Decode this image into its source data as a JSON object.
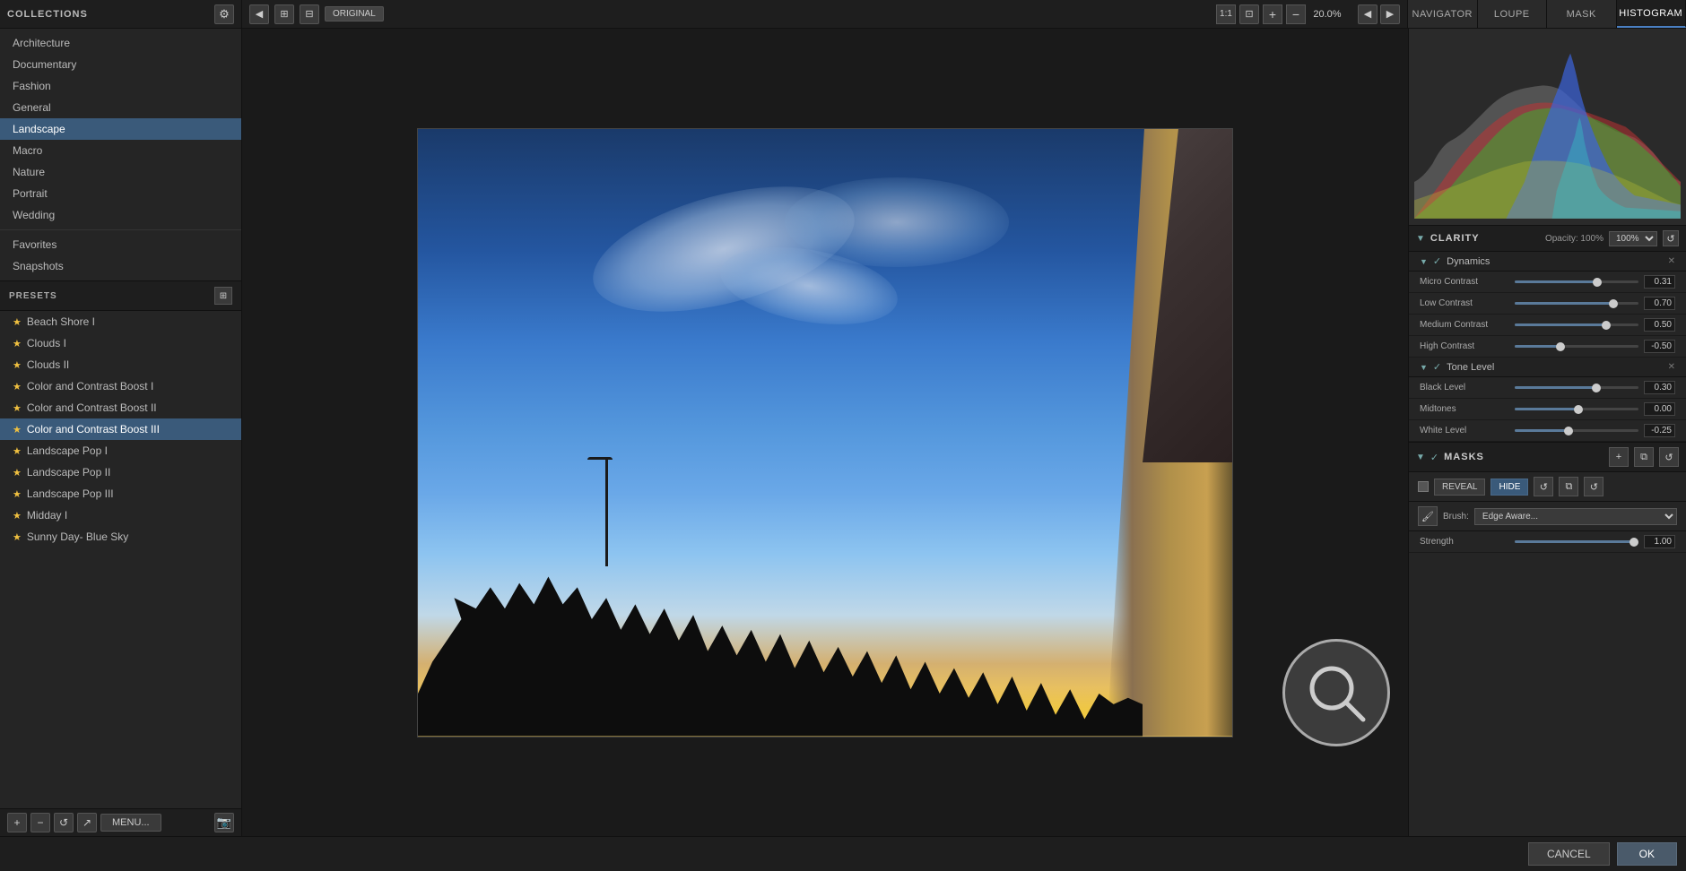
{
  "topbar": {
    "collections_label": "COLLECTIONS",
    "gear_icon": "⚙",
    "nav_prev_icon": "◀",
    "nav_next_icon": "▶",
    "view_icon1": "⊞",
    "view_icon2": "⊟",
    "original_label": "ORIGINAL",
    "zoom_1to1_label": "1:1",
    "fit_icon": "⊡",
    "zoom_in_icon": "+",
    "zoom_out_icon": "−",
    "zoom_percent": "20.0%",
    "toolbar_nav_prev": "◀",
    "toolbar_nav_next": "▶",
    "tabs": {
      "navigator": "NAVIGATOR",
      "loupe": "LOUPE",
      "mask": "MASK",
      "histogram": "HISTOGRAM"
    }
  },
  "collections": {
    "items": [
      {
        "label": "Architecture",
        "active": false
      },
      {
        "label": "Documentary",
        "active": false
      },
      {
        "label": "Fashion",
        "active": false
      },
      {
        "label": "General",
        "active": false
      },
      {
        "label": "Landscape",
        "active": true
      },
      {
        "label": "Macro",
        "active": false
      },
      {
        "label": "Nature",
        "active": false
      },
      {
        "label": "Portrait",
        "active": false
      },
      {
        "label": "Wedding",
        "active": false
      },
      {
        "label": "Favorites",
        "active": false
      },
      {
        "label": "Snapshots",
        "active": false
      }
    ]
  },
  "presets": {
    "title": "PRESETS",
    "grid_icon": "⊞",
    "items": [
      {
        "label": "Beach Shore I",
        "starred": true,
        "active": false
      },
      {
        "label": "Clouds I",
        "starred": true,
        "active": false
      },
      {
        "label": "Clouds II",
        "starred": true,
        "active": false
      },
      {
        "label": "Color and Contrast Boost I",
        "starred": true,
        "active": false
      },
      {
        "label": "Color and Contrast Boost II",
        "starred": true,
        "active": false
      },
      {
        "label": "Color and Contrast Boost III",
        "starred": true,
        "active": true
      },
      {
        "label": "Landscape Pop I",
        "starred": true,
        "active": false
      },
      {
        "label": "Landscape Pop II",
        "starred": true,
        "active": false
      },
      {
        "label": "Landscape Pop III",
        "starred": true,
        "active": false
      },
      {
        "label": "Midday I",
        "starred": true,
        "active": false
      },
      {
        "label": "Sunny Day- Blue Sky",
        "starred": true,
        "active": false
      }
    ]
  },
  "sidebar_bottom": {
    "add_icon": "+",
    "delete_icon": "−",
    "rotate_icon": "↺",
    "export_icon": "↗",
    "menu_label": "MENU...",
    "camera_icon": "📷"
  },
  "right_panel": {
    "active_tab": "HISTOGRAM",
    "clarity_section": {
      "title": "CLARITY",
      "opacity_label": "Opacity: 100%",
      "reset_icon": "↺",
      "dynamics_subsection": {
        "title": "Dynamics",
        "sliders": [
          {
            "label": "Micro Contrast",
            "value": "0.31",
            "fill_pct": 65
          },
          {
            "label": "Low Contrast",
            "value": "0.70",
            "fill_pct": 78
          },
          {
            "label": "Medium Contrast",
            "value": "0.50",
            "fill_pct": 72
          },
          {
            "label": "High Contrast",
            "value": "-0.50",
            "fill_pct": 35
          }
        ]
      },
      "tone_level_subsection": {
        "title": "Tone Level",
        "sliders": [
          {
            "label": "Black Level",
            "value": "0.30",
            "fill_pct": 64
          },
          {
            "label": "Midtones",
            "value": "0.00",
            "fill_pct": 50
          },
          {
            "label": "White Level",
            "value": "-0.25",
            "fill_pct": 42
          }
        ]
      }
    },
    "masks_section": {
      "title": "MASKS",
      "reveal_label": "REVEAL",
      "hide_label": "HIDE",
      "brush_label": "Brush:",
      "brush_value": "Edge Awa...",
      "strength_label": "Strength",
      "strength_value": "1.00"
    }
  },
  "bottom_bar": {
    "cancel_label": "CANCEL",
    "ok_label": "OK"
  }
}
